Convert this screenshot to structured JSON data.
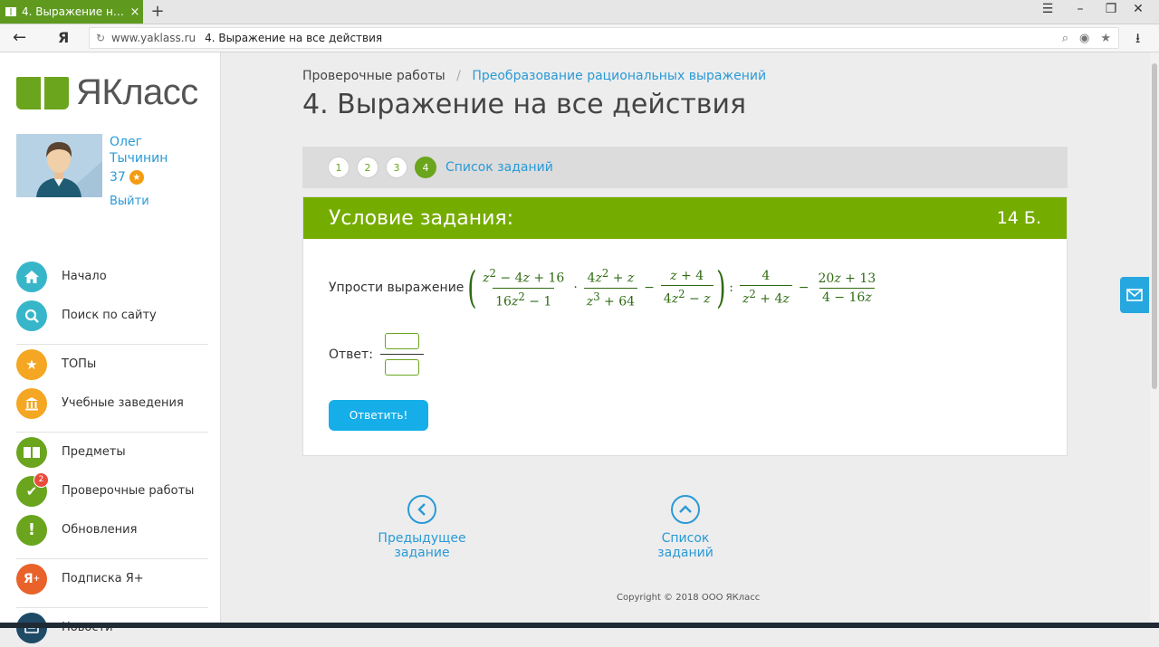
{
  "browser": {
    "tab_title": "4. Выражение на все действия",
    "new_tab": "+",
    "tab_close": "×",
    "back_glyph": "←",
    "yandex_glyph": "Я",
    "url_domain": "www.yaklass.ru",
    "url_title": "4. Выражение на все действия"
  },
  "sidebar": {
    "logo_text": "ЯКласс",
    "user_first": "Олег",
    "user_last": "Тычинин",
    "points": "37",
    "logout": "Выйти",
    "menu": [
      {
        "label": "Начало",
        "icon": "home-icon",
        "color": "#38b6c9"
      },
      {
        "label": "Поиск по сайту",
        "icon": "search-icon",
        "color": "#38b6c9"
      },
      {
        "label": "ТОПы",
        "icon": "star-icon",
        "color": "#f5a623"
      },
      {
        "label": "Учебные заведения",
        "icon": "institution-icon",
        "color": "#f5a623"
      },
      {
        "label": "Предметы",
        "icon": "book-icon",
        "color": "#6aa51d"
      },
      {
        "label": "Проверочные работы",
        "icon": "check-icon",
        "color": "#6aa51d",
        "badge": "2"
      },
      {
        "label": "Обновления",
        "icon": "exclamation-icon",
        "color": "#6aa51d"
      },
      {
        "label": "Подписка Я+",
        "icon": "ya-plus-icon",
        "color": "#e8622a"
      },
      {
        "label": "Новости",
        "icon": "news-icon",
        "color": "#1f4a66"
      }
    ]
  },
  "breadcrumb": {
    "parent": "Проверочные работы",
    "separator": "/",
    "current": "Преобразование рациональных выражений"
  },
  "page_title": "4. Выражение на все действия",
  "steps": {
    "items": [
      "1",
      "2",
      "3",
      "4"
    ],
    "active": "4",
    "task_list": "Список заданий"
  },
  "task": {
    "header": "Условие задания:",
    "points": "14 Б.",
    "prompt": "Упрости выражение",
    "answer_label": "Ответ:",
    "submit": "Ответить!"
  },
  "nav": {
    "prev": "Предыдущее задание",
    "list": "Список заданий"
  },
  "footer": {
    "copyright": "Copyright © 2018 ООО ЯКласс"
  },
  "colors": {
    "brand_green": "#75ac00",
    "link_blue": "#2a9ad6",
    "button_blue": "#16aee8"
  }
}
